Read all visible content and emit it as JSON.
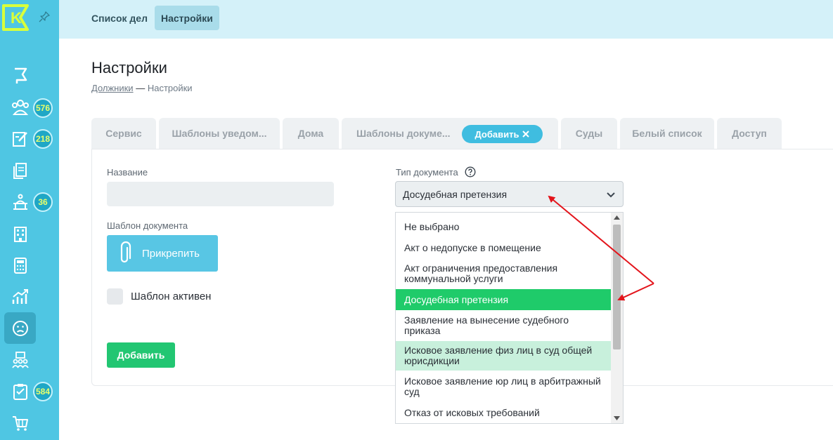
{
  "topbar": {
    "tabs": [
      {
        "label": "Список дел",
        "active": false
      },
      {
        "label": "Настройки",
        "active": true
      }
    ]
  },
  "sidebar": {
    "logo_letter": "K",
    "badges": {
      "debtors": "576",
      "tasks": "218",
      "court": "36",
      "checklist": "584"
    },
    "colors": {
      "background": "#4fc6e3",
      "active": "#39a8c4",
      "badge_text": "#e8ff6b"
    }
  },
  "page": {
    "title": "Настройки",
    "breadcrumb": {
      "link": "Должники",
      "separator": "—",
      "current": "Настройки"
    }
  },
  "tabs": {
    "items": [
      "Сервис",
      "Шаблоны уведом...",
      "Дома",
      "Шаблоны докуме...",
      "Суды",
      "Белый список",
      "Доступ"
    ],
    "add_chip": "Добавить"
  },
  "form": {
    "name_label": "Название",
    "name_value": "",
    "template_label": "Шаблон документа",
    "attach_button": "Прикрепить",
    "active_checkbox_label": "Шаблон активен",
    "submit_button": "Добавить",
    "doc_type_label": "Тип документа",
    "doc_type_selected": "Досудебная претензия"
  },
  "dropdown": {
    "options": [
      "Не выбрано",
      "Акт о недопуске в помещение",
      "Акт ограничения предоставления коммунальной услуги",
      "Досудебная претензия",
      "Заявление на вынесение судебного приказа",
      "Исковое заявление физ лиц в суд общей юрисдикции",
      "Исковое заявление юр лиц в арбитражный суд",
      "Отказ от исковых требований"
    ],
    "selected_index": 3,
    "hover_index": 5,
    "colors": {
      "selected": "#1fcb6a",
      "hover": "#c8f0dc"
    }
  }
}
